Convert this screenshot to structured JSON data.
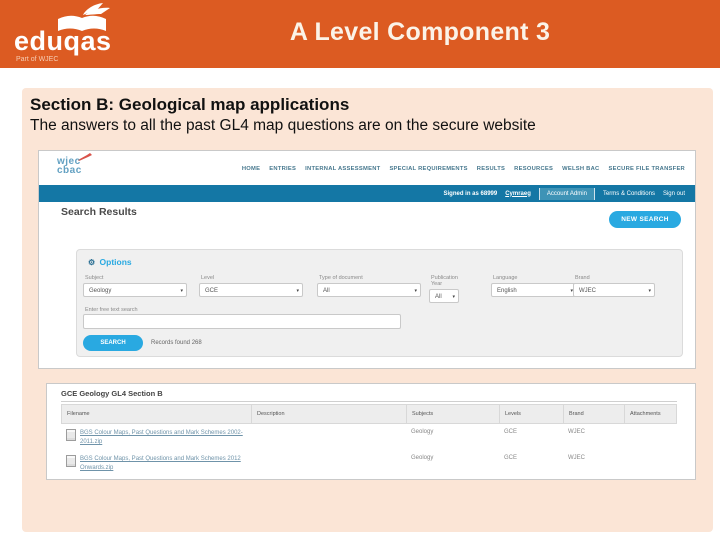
{
  "slide": {
    "header": {
      "logo_text": "eduqas",
      "logo_sub": "Part of WJEC",
      "title": "A Level Component 3"
    },
    "section": {
      "heading": "Section B: Geological map applications",
      "subheading": "The answers to all the past GL4 map questions are on the secure website"
    },
    "colors": {
      "header_orange": "#DC5B22",
      "panel_peach": "#FBE5D6",
      "site_teal_bar": "#1477A5",
      "accent_blue": "#29A9E1"
    }
  },
  "website": {
    "logo_line1": "wjec",
    "logo_line2": "cbac",
    "nav": [
      "HOME",
      "ENTRIES",
      "INTERNAL ASSESSMENT",
      "SPECIAL REQUIREMENTS",
      "RESULTS",
      "RESOURCES",
      "WELSH BAC",
      "SECURE FILE TRANSFER"
    ],
    "account_bar": {
      "signed_in": "Signed in as 68999",
      "cymraeg": "Cymraeg",
      "account_admin": "Account Admin",
      "terms": "Terms & Conditions",
      "sign_out": "Sign out"
    },
    "page_title": "Search Results",
    "new_search_label": "NEW SEARCH",
    "options": {
      "title": "Options",
      "filters": [
        {
          "label": "Subject",
          "value": "Geology"
        },
        {
          "label": "Level",
          "value": "GCE"
        },
        {
          "label": "Type of document",
          "value": "All"
        },
        {
          "label": "Publication Year",
          "value": "All"
        },
        {
          "label": "Language",
          "value": "English"
        },
        {
          "label": "Brand",
          "value": "WJEC"
        }
      ],
      "free_text_label": "Enter free text search",
      "search_label": "SEARCH",
      "records_found": "Records found 268"
    }
  },
  "results": {
    "title": "GCE Geology GL4 Section B",
    "columns": [
      "Filename",
      "Description",
      "Subjects",
      "Levels",
      "Brand",
      "Attachments"
    ],
    "rows": [
      {
        "filename": "BGS Colour Maps, Past Questions and Mark Schemes 2002-2011.zip",
        "description": "",
        "subjects": "Geology",
        "levels": "GCE",
        "brand": "WJEC",
        "attachments": ""
      },
      {
        "filename": "BGS Colour Maps, Past Questions and Mark Schemes 2012 Onwards.zip",
        "description": "",
        "subjects": "Geology",
        "levels": "GCE",
        "brand": "WJEC",
        "attachments": ""
      }
    ]
  }
}
